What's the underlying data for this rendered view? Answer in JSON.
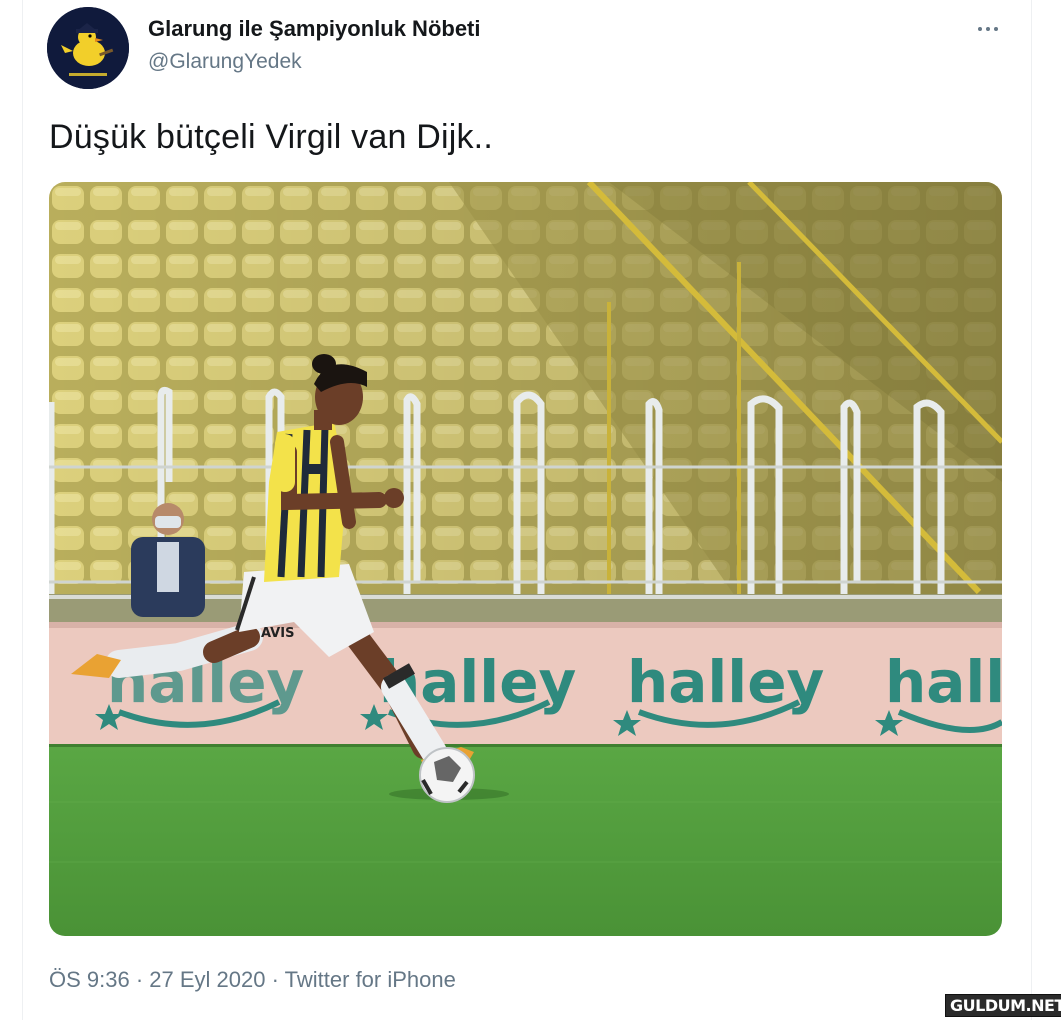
{
  "tweet": {
    "display_name": "Glarung ile Şampiyonluk Nöbeti",
    "handle": "@GlarungYedek",
    "avatar_icon": "yellow-bird-avatar-icon",
    "more_icon": "more-dots-icon",
    "text": "Düşük bütçeli Virgil van Dijk..",
    "media": {
      "description_icon": "photo-footballer-kicking-ball",
      "banner_text": "halley",
      "shirt_text": "AVIS"
    },
    "time": "ÖS 9:36",
    "date": "27 Eyl 2020",
    "source": "Twitter for iPhone",
    "separator": "·"
  },
  "watermark": "GULDUM.NET",
  "colors": {
    "text_primary": "#14171a",
    "text_secondary": "#657786",
    "avatar_bg": "#101a3c",
    "banner_teal": "#2f8a7e",
    "seat_yellow": "#d8cc78",
    "pitch_green": "#4f9a3c"
  }
}
